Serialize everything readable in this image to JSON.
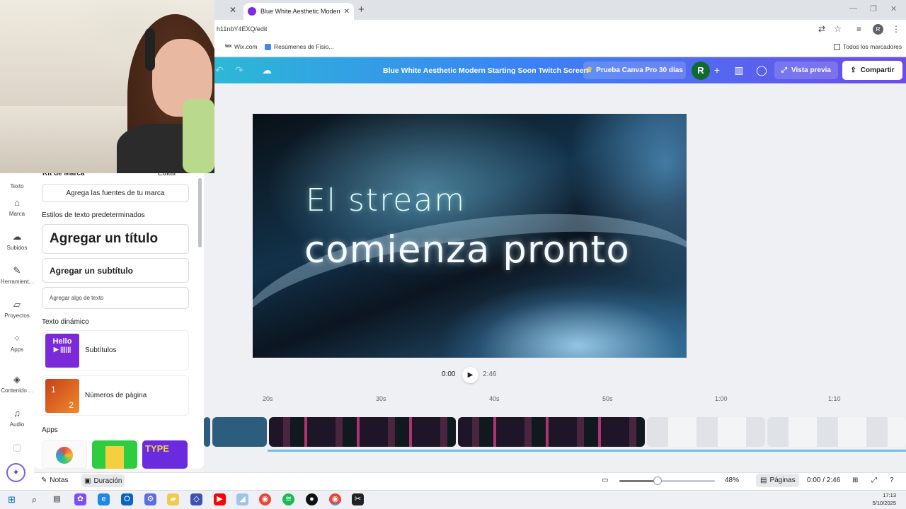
{
  "browser": {
    "tab_title": "Blue White Aesthetic Modern S",
    "url": "h11nbY4EXQ/edit",
    "bookmarks": [
      "Wix.com",
      "Resúmenes de Fisio...",
      "Todos los marcadores"
    ]
  },
  "header": {
    "doc_title": "Blue White Aesthetic Modern Starting Soon Twitch Screen",
    "pro_label": "Prueba Canva Pro 30 días",
    "avatar_initial": "R",
    "preview_label": "Vista previa",
    "share_label": "Compartir"
  },
  "rail": {
    "items": [
      {
        "label": "Texto",
        "icon": "text-icon"
      },
      {
        "label": "Marca",
        "icon": "brand-icon"
      },
      {
        "label": "Subidos",
        "icon": "upload-icon"
      },
      {
        "label": "Herramient...",
        "icon": "draw-icon"
      },
      {
        "label": "Proyectos",
        "icon": "folder-icon"
      },
      {
        "label": "Apps",
        "icon": "apps-icon"
      },
      {
        "label": "Contenido ...",
        "icon": "content-icon"
      },
      {
        "label": "Audio",
        "icon": "audio-icon"
      }
    ]
  },
  "panel": {
    "brand_kit": "Kit de Marca",
    "edit": "Editar",
    "add_brand_fonts": "Agrega las fuentes de tu marca",
    "default_styles_heading": "Estilos de texto predeterminados",
    "add_title": "Agregar un título",
    "add_subtitle": "Agregar un subtítulo",
    "add_body": "Agregar algo de texto",
    "dynamic_heading": "Texto dinámico",
    "dynamic_items": [
      "Subtítulos",
      "Números de página"
    ],
    "subtitle_thumb_text": "Hello",
    "page_thumb_digits": [
      "1",
      "2"
    ],
    "apps_heading": "Apps"
  },
  "canvas": {
    "line1": "El stream",
    "line2": "comienza pronto"
  },
  "playback": {
    "current": "0:00",
    "total": "2:46"
  },
  "timeline": {
    "ticks": [
      "20s",
      "30s",
      "40s",
      "50s",
      "1:00",
      "1:10"
    ]
  },
  "bottombar": {
    "notes": "Notas",
    "duration": "Duración",
    "zoom": "48%",
    "pages": "Páginas",
    "time": "0:00 / 2:46",
    "zoom_level": 0.4
  },
  "taskbar": {
    "time": "17:13",
    "date": "5/10/2025"
  },
  "colors": {
    "header_start": "#2cb8d6",
    "header_end": "#6d4ce8",
    "avatar": "#0f6b2e",
    "accent": "#7d2ae8"
  }
}
